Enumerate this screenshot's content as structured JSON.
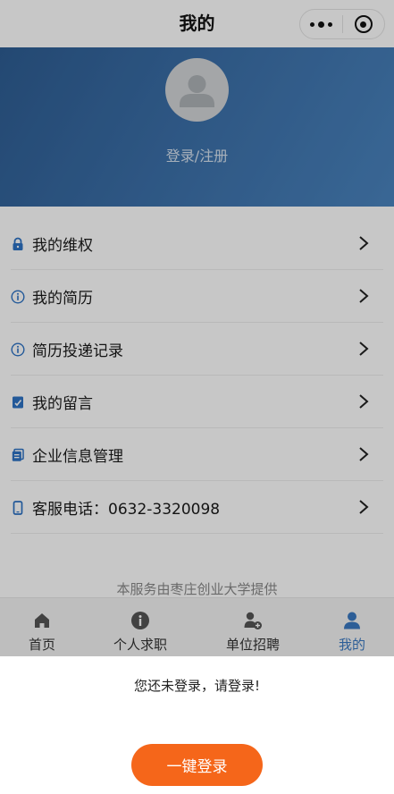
{
  "nav": {
    "title": "我的"
  },
  "header": {
    "login_text": "登录/注册"
  },
  "menu": {
    "items": [
      {
        "label": "我的维权",
        "icon": "lock-icon"
      },
      {
        "label": "我的简历",
        "icon": "info-circle-icon"
      },
      {
        "label": "简历投递记录",
        "icon": "info-circle-icon"
      },
      {
        "label": "我的留言",
        "icon": "message-edit-icon"
      },
      {
        "label": "企业信息管理",
        "icon": "document-icon"
      },
      {
        "label": "客服电话：0632-3320098",
        "icon": "phone-icon"
      }
    ]
  },
  "footer_note": "本服务由枣庄创业大学提供",
  "tabbar": {
    "tabs": [
      {
        "label": "首页",
        "icon": "home-icon"
      },
      {
        "label": "个人求职",
        "icon": "info-circle-icon"
      },
      {
        "label": "单位招聘",
        "icon": "add-user-icon"
      },
      {
        "label": "我的",
        "icon": "user-icon",
        "active": true
      }
    ]
  },
  "sheet": {
    "message": "您还未登录，请登录!",
    "button_label": "一键登录"
  },
  "colors": {
    "accent": "#3a79c2",
    "header_blue": "#3b6fa8",
    "login_button": "#f5661a"
  }
}
